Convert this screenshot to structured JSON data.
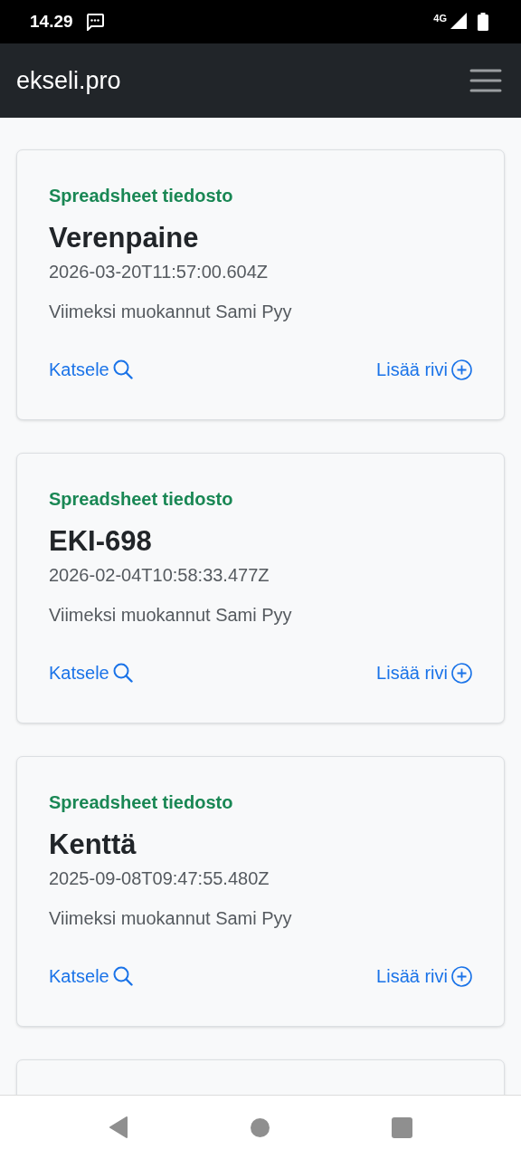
{
  "status_bar": {
    "time": "14.29",
    "network": "4G"
  },
  "navbar": {
    "brand": "ekseli.pro"
  },
  "cards": [
    {
      "kind": "file",
      "type_label": "Spreadsheet tiedosto",
      "title": "Verenpaine",
      "timestamp": "2026-03-20T11:57:00.604Z",
      "author": "Viimeksi muokannut Sami Pyy",
      "view_link": "Katsele",
      "add_link": "Lisää rivi"
    },
    {
      "kind": "file",
      "type_label": "Spreadsheet tiedosto",
      "title": "EKI-698",
      "timestamp": "2026-02-04T10:58:33.477Z",
      "author": "Viimeksi muokannut Sami Pyy",
      "view_link": "Katsele",
      "add_link": "Lisää rivi"
    },
    {
      "kind": "file",
      "type_label": "Spreadsheet tiedosto",
      "title": "Kenttä",
      "timestamp": "2025-09-08T09:47:55.480Z",
      "author": "Viimeksi muokannut Sami Pyy",
      "view_link": "Katsele",
      "add_link": "Lisää rivi"
    },
    {
      "kind": "partial"
    }
  ]
}
